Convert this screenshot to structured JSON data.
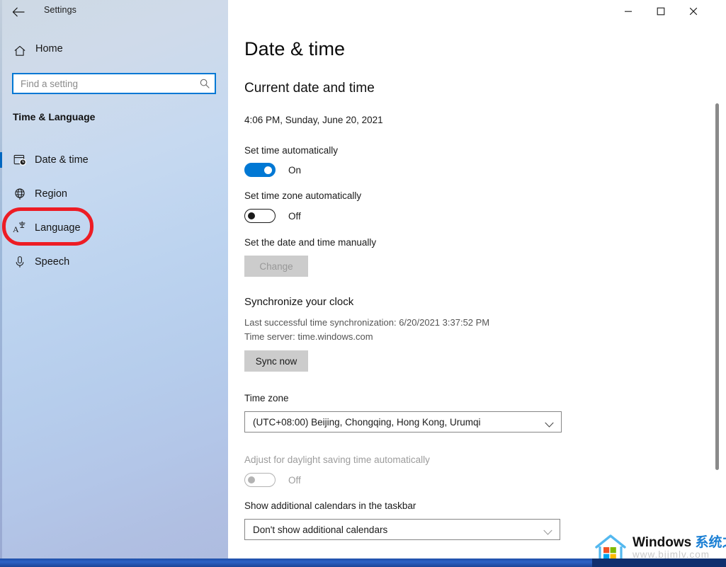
{
  "window": {
    "app_title": "Settings",
    "back_icon": "back-arrow-icon",
    "minimize_label": "Minimize",
    "maximize_label": "Maximize",
    "close_label": "Close"
  },
  "sidebar": {
    "home_label": "Home",
    "home_icon": "home-icon",
    "search": {
      "placeholder": "Find a setting",
      "value": "",
      "icon": "search-icon"
    },
    "section_title": "Time & Language",
    "items": [
      {
        "label": "Date & time",
        "icon": "calendar-clock-icon",
        "selected": true
      },
      {
        "label": "Region",
        "icon": "globe-icon",
        "selected": false
      },
      {
        "label": "Language",
        "icon": "language-a-icon",
        "selected": false
      },
      {
        "label": "Speech",
        "icon": "microphone-icon",
        "selected": false
      }
    ],
    "annotation": {
      "type": "red-rounded-rectangle",
      "targets": "Language",
      "color": "#ed1c24"
    }
  },
  "main": {
    "page_title": "Date & time",
    "current": {
      "heading": "Current date and time",
      "value": "4:06 PM, Sunday, June 20, 2021"
    },
    "set_time_automatically": {
      "label": "Set time automatically",
      "state": "On",
      "enabled": true,
      "on": true
    },
    "set_time_zone_automatically": {
      "label": "Set time zone automatically",
      "state": "Off",
      "enabled": true,
      "on": false
    },
    "set_manually": {
      "label": "Set the date and time manually",
      "button_label": "Change",
      "button_enabled": false
    },
    "synchronize": {
      "heading": "Synchronize your clock",
      "last_sync": "Last successful time synchronization: 6/20/2021 3:37:52 PM",
      "time_server": "Time server: time.windows.com",
      "button_label": "Sync now"
    },
    "time_zone": {
      "label": "Time zone",
      "selected": "(UTC+08:00) Beijing, Chongqing, Hong Kong, Urumqi",
      "chevron": "chevron-down-icon"
    },
    "daylight_saving": {
      "label": "Adjust for daylight saving time automatically",
      "state": "Off",
      "enabled": false,
      "on": false
    },
    "additional_calendars": {
      "label": "Show additional calendars in the taskbar",
      "selected": "Don't show additional calendars",
      "chevron": "chevron-down-icon"
    }
  },
  "watermark": {
    "brand_en": "Windows ",
    "brand_cn": "系统之家",
    "url": "www.bjjmlv.com"
  },
  "colors": {
    "accent": "#0078d4",
    "selection_bar": "#0067c0",
    "annotation_red": "#ed1c24",
    "brand_blue": "#1a7fd4"
  }
}
